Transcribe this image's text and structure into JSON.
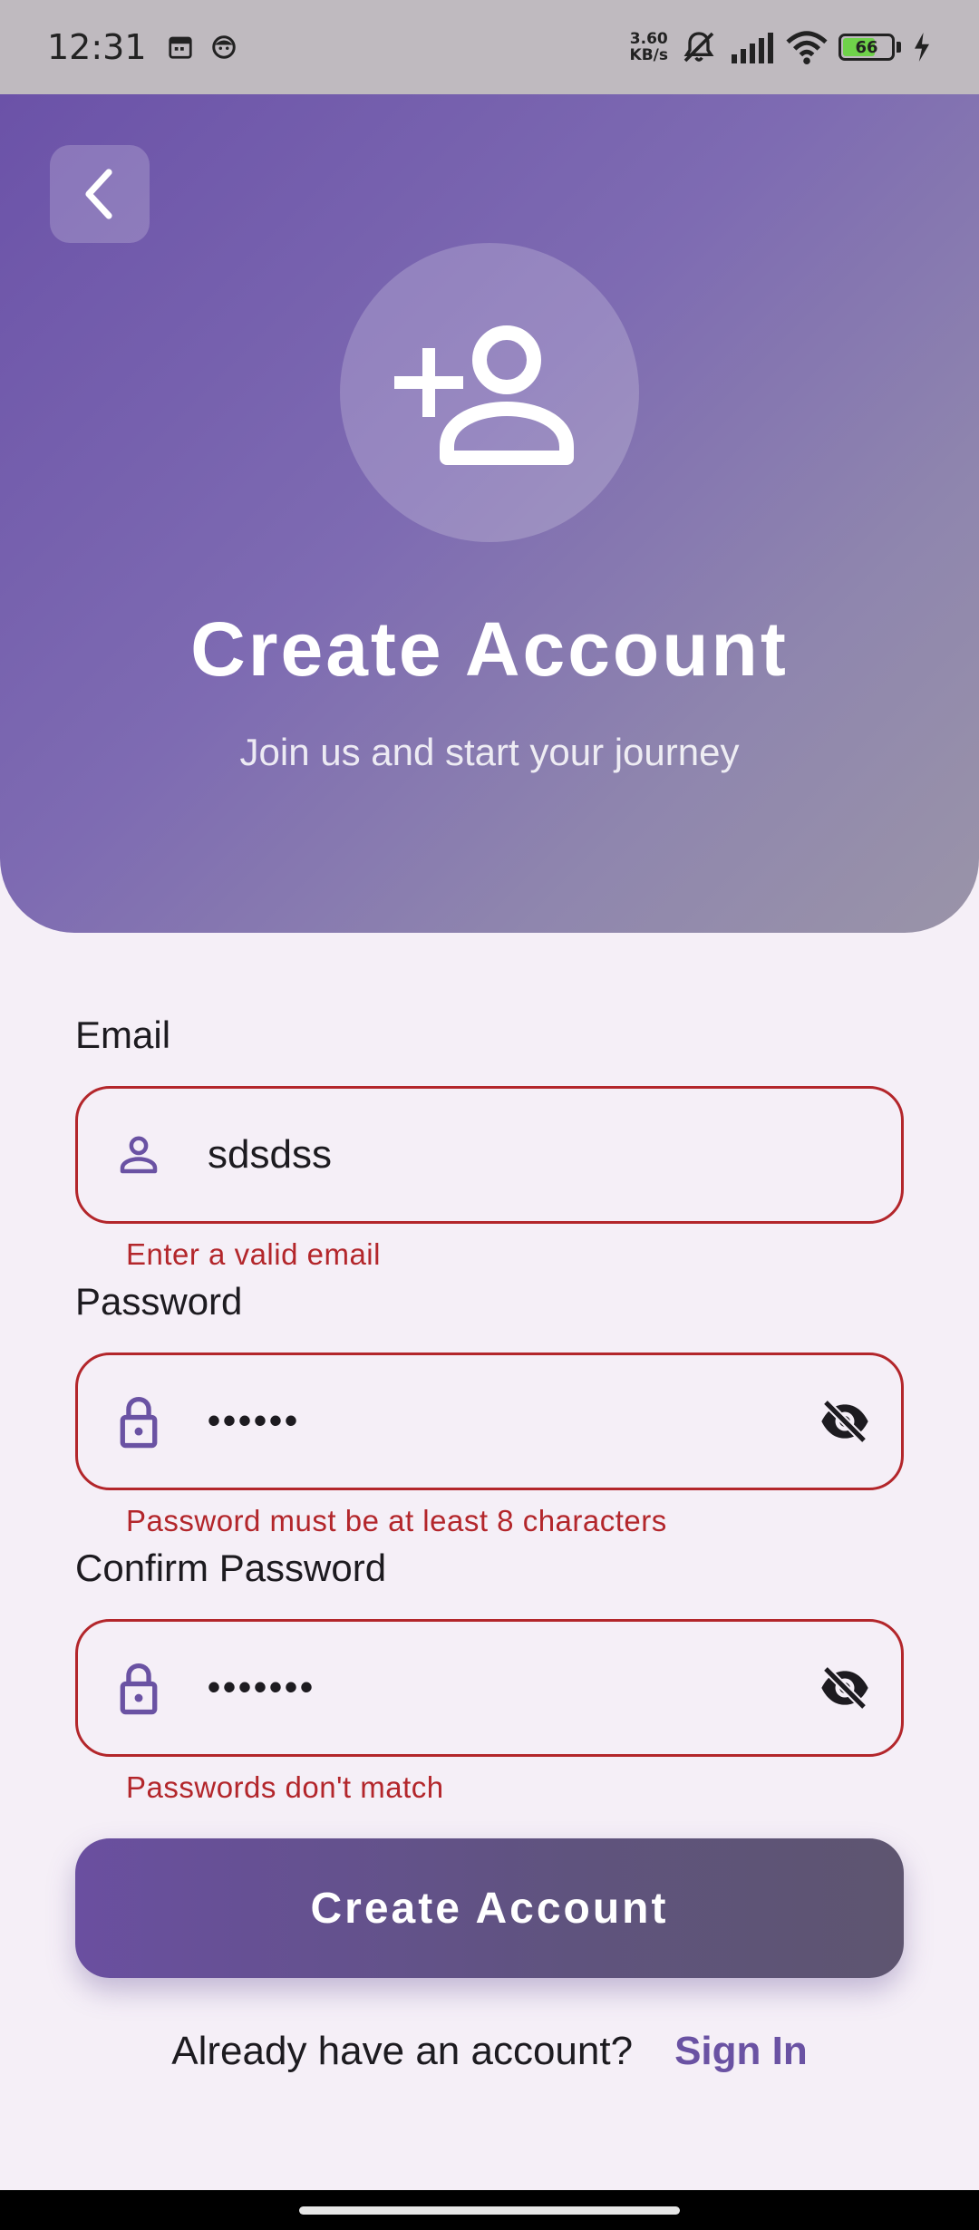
{
  "status_bar": {
    "time": "12:31",
    "net_speed_value": "3.60",
    "net_speed_unit": "KB/s",
    "battery_level": "66"
  },
  "header": {
    "title": "Create Account",
    "subtitle": "Join us and start your journey"
  },
  "form": {
    "email": {
      "label": "Email",
      "value": "sdsdss",
      "error": "Enter a valid email"
    },
    "password": {
      "label": "Password",
      "value": "••••••",
      "error": "Password must be at least 8 characters"
    },
    "confirm_password": {
      "label": "Confirm Password",
      "value": "•••••••",
      "error": "Passwords don't match"
    },
    "submit_label": "Create Account"
  },
  "footer": {
    "prompt": "Already have an account?",
    "link": "Sign In"
  },
  "colors": {
    "accent": "#6a52a3",
    "error": "#b3262b",
    "background": "#f5eff7"
  },
  "icons": [
    "back-arrow-icon",
    "person-add-icon",
    "person-icon",
    "lock-icon",
    "visibility-off-icon"
  ]
}
